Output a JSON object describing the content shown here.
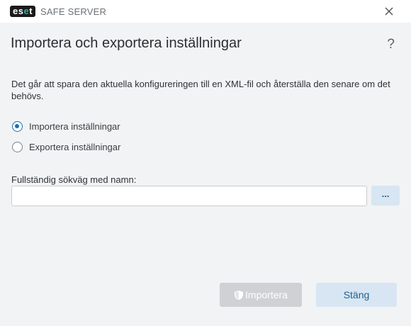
{
  "app": {
    "logo_text": "eset",
    "product_name": "SAFE SERVER"
  },
  "dialog": {
    "title": "Importera och exportera inställningar",
    "help_label": "?",
    "description": "Det går att spara den aktuella konfigureringen till en XML-fil och återställa den senare om det behövs."
  },
  "options": [
    {
      "label": "Importera inställningar",
      "selected": true
    },
    {
      "label": "Exportera inställningar",
      "selected": false
    }
  ],
  "path_field": {
    "label": "Fullständig sökväg med namn:",
    "value": "",
    "placeholder": ""
  },
  "browse_label": "...",
  "buttons": {
    "import_label": "Importera",
    "import_enabled": false,
    "close_label": "Stäng"
  },
  "colors": {
    "accent": "#1f6fa8",
    "secondary_button_bg": "#d7e6f2",
    "disabled_button_bg": "#cfd1d4",
    "brand_teal": "#24b3a8"
  }
}
